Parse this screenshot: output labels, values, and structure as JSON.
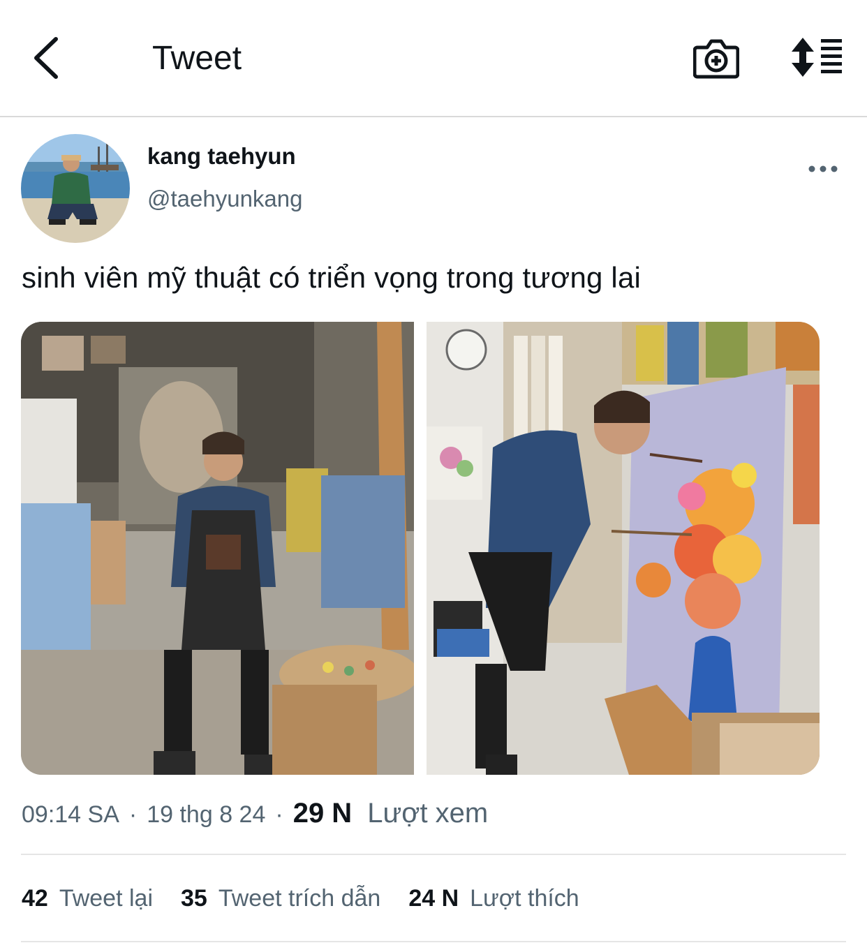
{
  "header": {
    "title": "Tweet",
    "back_icon": "chevron-left-icon",
    "camera_icon": "camera-add-icon",
    "sort_icon": "sort-list-icon"
  },
  "author": {
    "display_name": "kang taehyun",
    "handle": "@taehyunkang"
  },
  "tweet": {
    "text": "sinh viên mỹ thuật có triển vọng trong tương lai"
  },
  "meta": {
    "time": "09:14 SA",
    "separator": "·",
    "date": "19 thg 8 24",
    "views_count": "29 N",
    "views_label": "Lượt xem"
  },
  "stats": {
    "retweets_count": "42",
    "retweets_label": "Tweet lại",
    "quotes_count": "35",
    "quotes_label": "Tweet trích dẫn",
    "likes_count": "24 N",
    "likes_label": "Lượt thích"
  },
  "colors": {
    "text_primary": "#0f1419",
    "text_secondary": "#536471",
    "divider": "#e5e5e5"
  }
}
